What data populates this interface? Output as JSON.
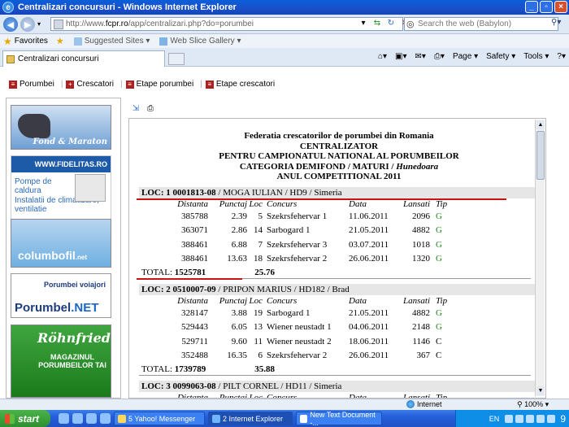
{
  "window": {
    "title": "Centralizari concursuri - Windows Internet Explorer"
  },
  "address": {
    "url_prefix": "http://www.",
    "url_domain": "fcpr.ro",
    "url_path": "/app/centralizari.php?do=porumbei",
    "search_placeholder": "Search the web (Babylon)"
  },
  "favorites": {
    "label": "Favorites",
    "items": [
      "Suggested Sites ▾",
      "Web Slice Gallery ▾"
    ]
  },
  "tab": {
    "label": "Centralizari concursuri"
  },
  "commandbar": {
    "page": "Page ▾",
    "safety": "Safety ▾",
    "tools": "Tools ▾",
    "help": "?▾"
  },
  "sitemenu": {
    "items": [
      "Porumbei",
      "Crescatori",
      "Etape porumbei",
      "Etape crescatori"
    ]
  },
  "sidebar": {
    "banner1": "Fond & Maraton",
    "banner2_head": "WWW.FIDELITAS.RO",
    "banner2_l1": "Pompe de caldura",
    "banner2_l2": "Instalatii de climatizare, ventilatie",
    "banner3_main": "columbofil",
    "banner3_tag": ".net",
    "banner4_line1": "Porumbei voiajori",
    "banner4_main": "Porumbel",
    "banner4_net": ".NET",
    "banner5_title": "Röhnfried",
    "banner5_sub": "MAGAZINUL PORUMBEILOR TAI"
  },
  "report": {
    "header": [
      "Federatia crescatorilor de porumbei din Romania",
      "CENTRALIZATOR",
      "PENTRU CAMPIONATUL NATIONAL AL PORUMBEILOR",
      "CATEGORIA DEMIFOND / MATURI / ",
      "ANUL COMPETITIONAL 2011"
    ],
    "header_county": "Hunedoara",
    "columns": [
      "Distanta",
      "Punctaj",
      "Loc",
      "Concurs",
      "Data",
      "Lansati",
      "Tip"
    ],
    "entries": [
      {
        "loc_label": "LOC: 1",
        "ring": "0001813-08",
        "rest": " / MOGA IULIAN / HD9 / Simeria",
        "rows": [
          [
            "385788",
            "2.39",
            "5",
            "Szekrsfehervar 1",
            "11.06.2011",
            "2096",
            "G"
          ],
          [
            "363071",
            "2.86",
            "14",
            "Sarbogard 1",
            "21.05.2011",
            "4882",
            "G"
          ],
          [
            "388461",
            "6.88",
            "7",
            "Szekrsfehervar 3",
            "03.07.2011",
            "1018",
            "G"
          ],
          [
            "388461",
            "13.63",
            "18",
            "Szekrsfehervar 2",
            "26.06.2011",
            "1320",
            "G"
          ]
        ],
        "total_label": "TOTAL:",
        "total_dist": "1525781",
        "total_score": "25.76"
      },
      {
        "loc_label": "LOC: 2",
        "ring": "0510007-09",
        "rest": " / PRIPON MARIUS / HD182 / Brad",
        "rows": [
          [
            "328147",
            "3.88",
            "19",
            "Sarbogard 1",
            "21.05.2011",
            "4882",
            "G"
          ],
          [
            "529443",
            "6.05",
            "13",
            "Wiener neustadt 1",
            "04.06.2011",
            "2148",
            "G"
          ],
          [
            "529711",
            "9.60",
            "11",
            "Wiener neustadt 2",
            "18.06.2011",
            "1146",
            "C"
          ],
          [
            "352488",
            "16.35",
            "6",
            "Szekrsfehervar 2",
            "26.06.2011",
            "367",
            "C"
          ]
        ],
        "total_label": "TOTAL:",
        "total_dist": "1739789",
        "total_score": "35.88"
      },
      {
        "loc_label": "LOC: 3",
        "ring": "0099063-08",
        "rest": " / PILT CORNEL / HD11 / Simeria",
        "rows": [
          [
            "",
            "",
            "",
            "",
            "",
            "",
            ""
          ]
        ]
      }
    ]
  },
  "statusbar": {
    "zone": "Internet",
    "zoom": "100%"
  },
  "taskbar": {
    "start": "start",
    "buttons": [
      "5 Yahoo! Messenger",
      "2 Internet Explorer",
      "New Text Document -..."
    ],
    "lang": "EN",
    "time": "9"
  }
}
